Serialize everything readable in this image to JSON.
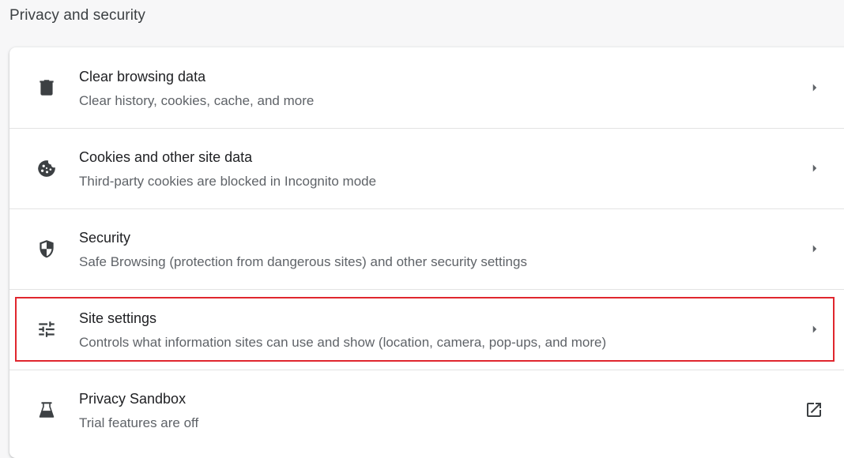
{
  "section": {
    "title": "Privacy and security"
  },
  "items": [
    {
      "label": "Clear browsing data",
      "sublabel": "Clear history, cookies, cache, and more",
      "icon": "trash-icon",
      "trailing": "chevron-right-icon"
    },
    {
      "label": "Cookies and other site data",
      "sublabel": "Third-party cookies are blocked in Incognito mode",
      "icon": "cookie-icon",
      "trailing": "chevron-right-icon"
    },
    {
      "label": "Security",
      "sublabel": "Safe Browsing (protection from dangerous sites) and other security settings",
      "icon": "shield-icon",
      "trailing": "chevron-right-icon"
    },
    {
      "label": "Site settings",
      "sublabel": "Controls what information sites can use and show (location, camera, pop-ups, and more)",
      "icon": "tune-sliders-icon",
      "trailing": "chevron-right-icon",
      "highlighted": true
    },
    {
      "label": "Privacy Sandbox",
      "sublabel": "Trial features are off",
      "icon": "flask-icon",
      "trailing": "open-in-new-icon"
    }
  ],
  "colors": {
    "highlight": "#e0262e",
    "text_primary": "#202124",
    "text_secondary": "#5f6368"
  }
}
